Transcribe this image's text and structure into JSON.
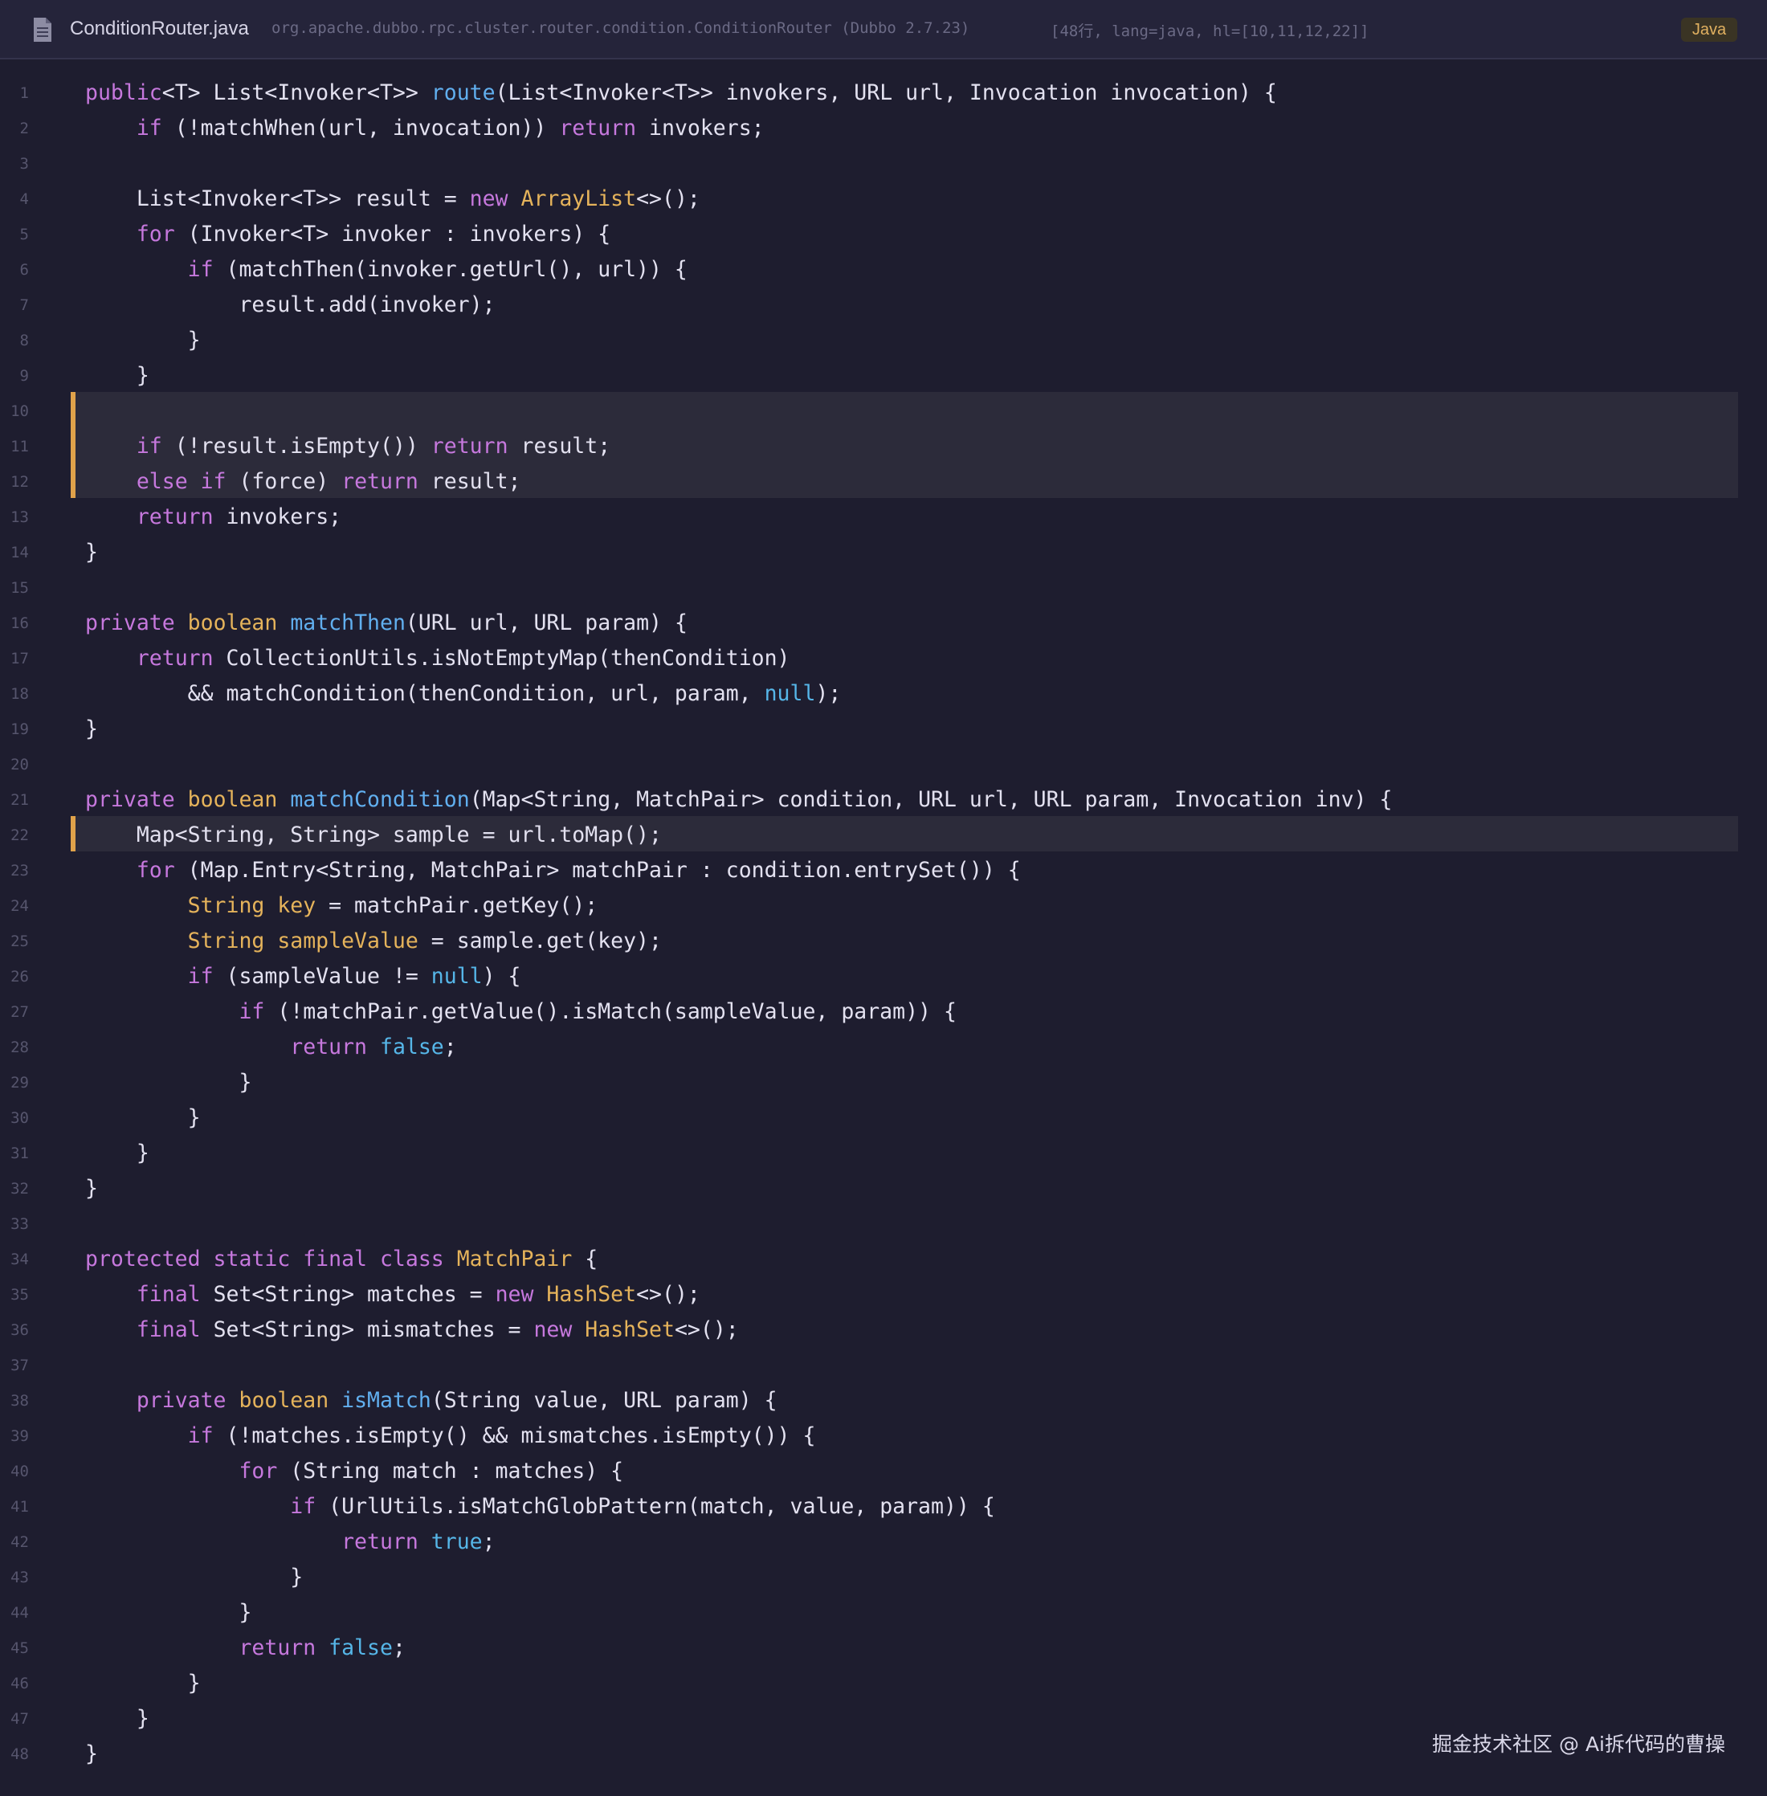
{
  "header": {
    "file_name": "ConditionRouter.java",
    "class_path": "org.apache.dubbo.rpc.cluster.router.condition.ConditionRouter (Dubbo 2.7.23)",
    "meta": "[48行, lang=java, hl=[10,11,12,22]]",
    "language_badge": "Java"
  },
  "highlighted_lines": [
    10,
    11,
    12,
    22
  ],
  "colors": {
    "background": "#1e1d2f",
    "keyword": "#c678dd",
    "function": "#61afef",
    "type": "#e5b35b",
    "literal": "#56b6e8",
    "highlight_bar": "#e0a24a"
  },
  "code_lines": [
    [
      [
        "kw",
        "public"
      ],
      [
        "",
        "<T> List<Invoker<T>> "
      ],
      [
        "fn",
        "route"
      ],
      [
        "",
        "(List<Invoker<T>> invokers, URL url, Invocation invocation) {"
      ]
    ],
    [
      [
        "",
        "    "
      ],
      [
        "kw",
        "if"
      ],
      [
        "",
        " (!matchWhen(url, invocation)) "
      ],
      [
        "kw",
        "return"
      ],
      [
        "",
        " invokers;"
      ]
    ],
    [],
    [
      [
        "",
        "    List<Invoker<T>> result = "
      ],
      [
        "kw",
        "new"
      ],
      [
        "",
        " "
      ],
      [
        "ty",
        "ArrayList"
      ],
      [
        "",
        "<>();"
      ]
    ],
    [
      [
        "",
        "    "
      ],
      [
        "kw",
        "for"
      ],
      [
        "",
        " (Invoker<T> invoker : invokers) {"
      ]
    ],
    [
      [
        "",
        "        "
      ],
      [
        "kw",
        "if"
      ],
      [
        "",
        " (matchThen(invoker.getUrl(), url)) {"
      ]
    ],
    [
      [
        "",
        "            result.add(invoker);"
      ]
    ],
    [
      [
        "",
        "        }"
      ]
    ],
    [
      [
        "",
        "    }"
      ]
    ],
    [],
    [
      [
        "",
        "    "
      ],
      [
        "kw",
        "if"
      ],
      [
        "",
        " (!result.isEmpty()) "
      ],
      [
        "kw",
        "return"
      ],
      [
        "",
        " result;"
      ]
    ],
    [
      [
        "",
        "    "
      ],
      [
        "kw",
        "else if"
      ],
      [
        "",
        " (force) "
      ],
      [
        "kw",
        "return"
      ],
      [
        "",
        " result;"
      ]
    ],
    [
      [
        "",
        "    "
      ],
      [
        "kw",
        "return"
      ],
      [
        "",
        " invokers;"
      ]
    ],
    [
      [
        "",
        "}"
      ]
    ],
    [],
    [
      [
        "kw",
        "private"
      ],
      [
        "",
        " "
      ],
      [
        "ty",
        "boolean"
      ],
      [
        "",
        " "
      ],
      [
        "fn",
        "matchThen"
      ],
      [
        "",
        "(URL url, URL param) {"
      ]
    ],
    [
      [
        "",
        "    "
      ],
      [
        "kw",
        "return"
      ],
      [
        "",
        " CollectionUtils.isNotEmptyMap(thenCondition)"
      ]
    ],
    [
      [
        "",
        "        && matchCondition(thenCondition, url, param, "
      ],
      [
        "lit",
        "null"
      ],
      [
        "",
        ");"
      ]
    ],
    [
      [
        "",
        "}"
      ]
    ],
    [],
    [
      [
        "kw",
        "private"
      ],
      [
        "",
        " "
      ],
      [
        "ty",
        "boolean"
      ],
      [
        "",
        " "
      ],
      [
        "fn",
        "matchCondition"
      ],
      [
        "",
        "(Map<String, MatchPair> condition, URL url, URL param, Invocation inv) {"
      ]
    ],
    [
      [
        "",
        "    Map<String, String> sample = url.toMap();"
      ]
    ],
    [
      [
        "",
        "    "
      ],
      [
        "kw",
        "for"
      ],
      [
        "",
        " (Map.Entry<String, MatchPair> matchPair : condition.entrySet()) {"
      ]
    ],
    [
      [
        "",
        "        "
      ],
      [
        "ty",
        "String key"
      ],
      [
        "",
        " = matchPair.getKey();"
      ]
    ],
    [
      [
        "",
        "        "
      ],
      [
        "ty",
        "String sampleValue"
      ],
      [
        "",
        " = sample.get(key);"
      ]
    ],
    [
      [
        "",
        "        "
      ],
      [
        "kw",
        "if"
      ],
      [
        "",
        " (sampleValue != "
      ],
      [
        "lit",
        "null"
      ],
      [
        "",
        ") {"
      ]
    ],
    [
      [
        "",
        "            "
      ],
      [
        "kw",
        "if"
      ],
      [
        "",
        " (!matchPair.getValue().isMatch(sampleValue, param)) {"
      ]
    ],
    [
      [
        "",
        "                "
      ],
      [
        "kw",
        "return"
      ],
      [
        "",
        " "
      ],
      [
        "lit",
        "false"
      ],
      [
        "",
        ";"
      ]
    ],
    [
      [
        "",
        "            }"
      ]
    ],
    [
      [
        "",
        "        }"
      ]
    ],
    [
      [
        "",
        "    }"
      ]
    ],
    [
      [
        "",
        "}"
      ]
    ],
    [],
    [
      [
        "kw",
        "protected static final class"
      ],
      [
        "",
        " "
      ],
      [
        "ty",
        "MatchPair"
      ],
      [
        "",
        " {"
      ]
    ],
    [
      [
        "",
        "    "
      ],
      [
        "kw",
        "final"
      ],
      [
        "",
        " Set<String> matches = "
      ],
      [
        "kw",
        "new"
      ],
      [
        "",
        " "
      ],
      [
        "ty",
        "HashSet"
      ],
      [
        "",
        "<>();"
      ]
    ],
    [
      [
        "",
        "    "
      ],
      [
        "kw",
        "final"
      ],
      [
        "",
        " Set<String> mismatches = "
      ],
      [
        "kw",
        "new"
      ],
      [
        "",
        " "
      ],
      [
        "ty",
        "HashSet"
      ],
      [
        "",
        "<>();"
      ]
    ],
    [],
    [
      [
        "",
        "    "
      ],
      [
        "kw",
        "private"
      ],
      [
        "",
        " "
      ],
      [
        "ty",
        "boolean"
      ],
      [
        "",
        " "
      ],
      [
        "fn",
        "isMatch"
      ],
      [
        "",
        "(String value, URL param) {"
      ]
    ],
    [
      [
        "",
        "        "
      ],
      [
        "kw",
        "if"
      ],
      [
        "",
        " (!matches.isEmpty() && mismatches.isEmpty()) {"
      ]
    ],
    [
      [
        "",
        "            "
      ],
      [
        "kw",
        "for"
      ],
      [
        "",
        " (String match : matches) {"
      ]
    ],
    [
      [
        "",
        "                "
      ],
      [
        "kw",
        "if"
      ],
      [
        "",
        " (UrlUtils.isMatchGlobPattern(match, value, param)) {"
      ]
    ],
    [
      [
        "",
        "                    "
      ],
      [
        "kw",
        "return"
      ],
      [
        "",
        " "
      ],
      [
        "lit",
        "true"
      ],
      [
        "",
        ";"
      ]
    ],
    [
      [
        "",
        "                }"
      ]
    ],
    [
      [
        "",
        "            }"
      ]
    ],
    [
      [
        "",
        "            "
      ],
      [
        "kw",
        "return"
      ],
      [
        "",
        " "
      ],
      [
        "lit",
        "false"
      ],
      [
        "",
        ";"
      ]
    ],
    [
      [
        "",
        "        }"
      ]
    ],
    [
      [
        "",
        "    }"
      ]
    ],
    [
      [
        "",
        "}"
      ]
    ]
  ],
  "watermark": "掘金技术社区 @ Ai拆代码的曹操"
}
